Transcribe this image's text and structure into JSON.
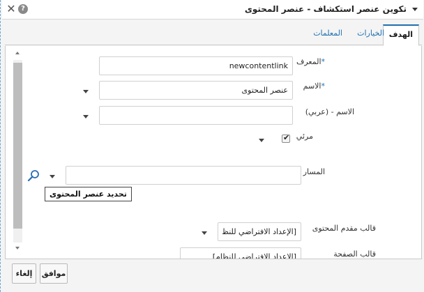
{
  "window": {
    "title": "تكوين عنصر استكشاف - عنصر المحتوى",
    "close_label": "✕",
    "help_label": "?"
  },
  "tabs": [
    {
      "label": "الهدف",
      "active": true
    },
    {
      "label": "الخيارات",
      "active": false
    },
    {
      "label": "المعلمات",
      "active": false
    }
  ],
  "form": {
    "identifier": {
      "label": "المعرف",
      "required_mark": "*",
      "value": "newcontentlink"
    },
    "name": {
      "label": "الاسم",
      "required_mark": "*",
      "value": "عنصر المحتوى"
    },
    "name_arabic": {
      "label": "الاسم - (عربي)",
      "value": ""
    },
    "visible": {
      "label": "مرئي",
      "checked": true,
      "check_glyph": "✔"
    },
    "path": {
      "label": "المسار",
      "value": "",
      "tooltip": "تحديد عنصر المحتوى"
    },
    "content_presenter_template": {
      "label": "قالب مقدم المحتوى",
      "value": "[الإعداد الافتراضي للنظام]"
    },
    "page_template": {
      "label": "قالب الصفحة",
      "value": "[الإعداد الافتراضي للنظام]"
    }
  },
  "footer": {
    "ok_label": "موافق",
    "cancel_label": "إلغاء"
  },
  "colors": {
    "accent": "#1f6fb0",
    "focus_border": "#6aa7d8"
  }
}
